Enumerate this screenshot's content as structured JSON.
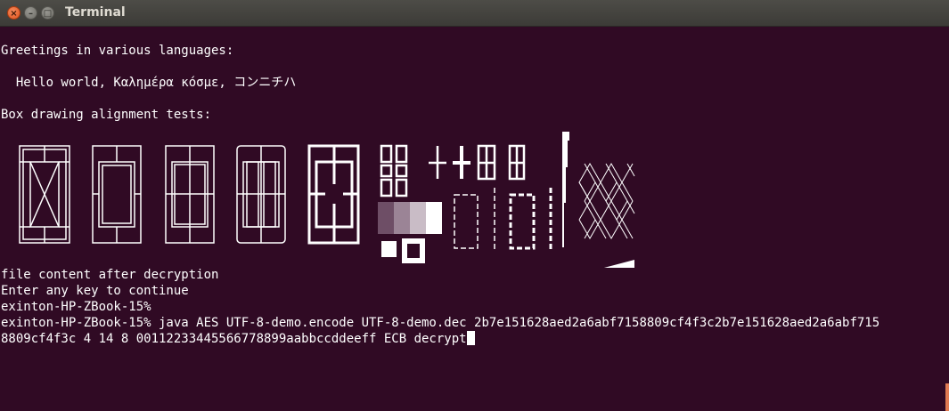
{
  "window": {
    "title": "Terminal"
  },
  "terminal": {
    "lines": {
      "l1": "Greetings in various languages:",
      "l2": "  Hello world, Καλημέρα κόσμε, コンニチハ",
      "l3": "Box drawing alignment tests:",
      "l4": "file content after decryption",
      "l5": "Enter any key to continue",
      "l6": "exinton-HP-ZBook-15%",
      "l7": "exinton-HP-ZBook-15% java AES UTF-8-demo.encode UTF-8-demo.dec 2b7e151628aed2a6abf7158809cf4f3c2b7e151628aed2a6abf715",
      "l8": "8809cf4f3c 4 14 8 00112233445566778899aabbccddeeff ECB decrypt"
    }
  },
  "colors": {
    "background": "#300a24",
    "foreground": "#ffffff",
    "titlebar": "#3c3b37"
  }
}
